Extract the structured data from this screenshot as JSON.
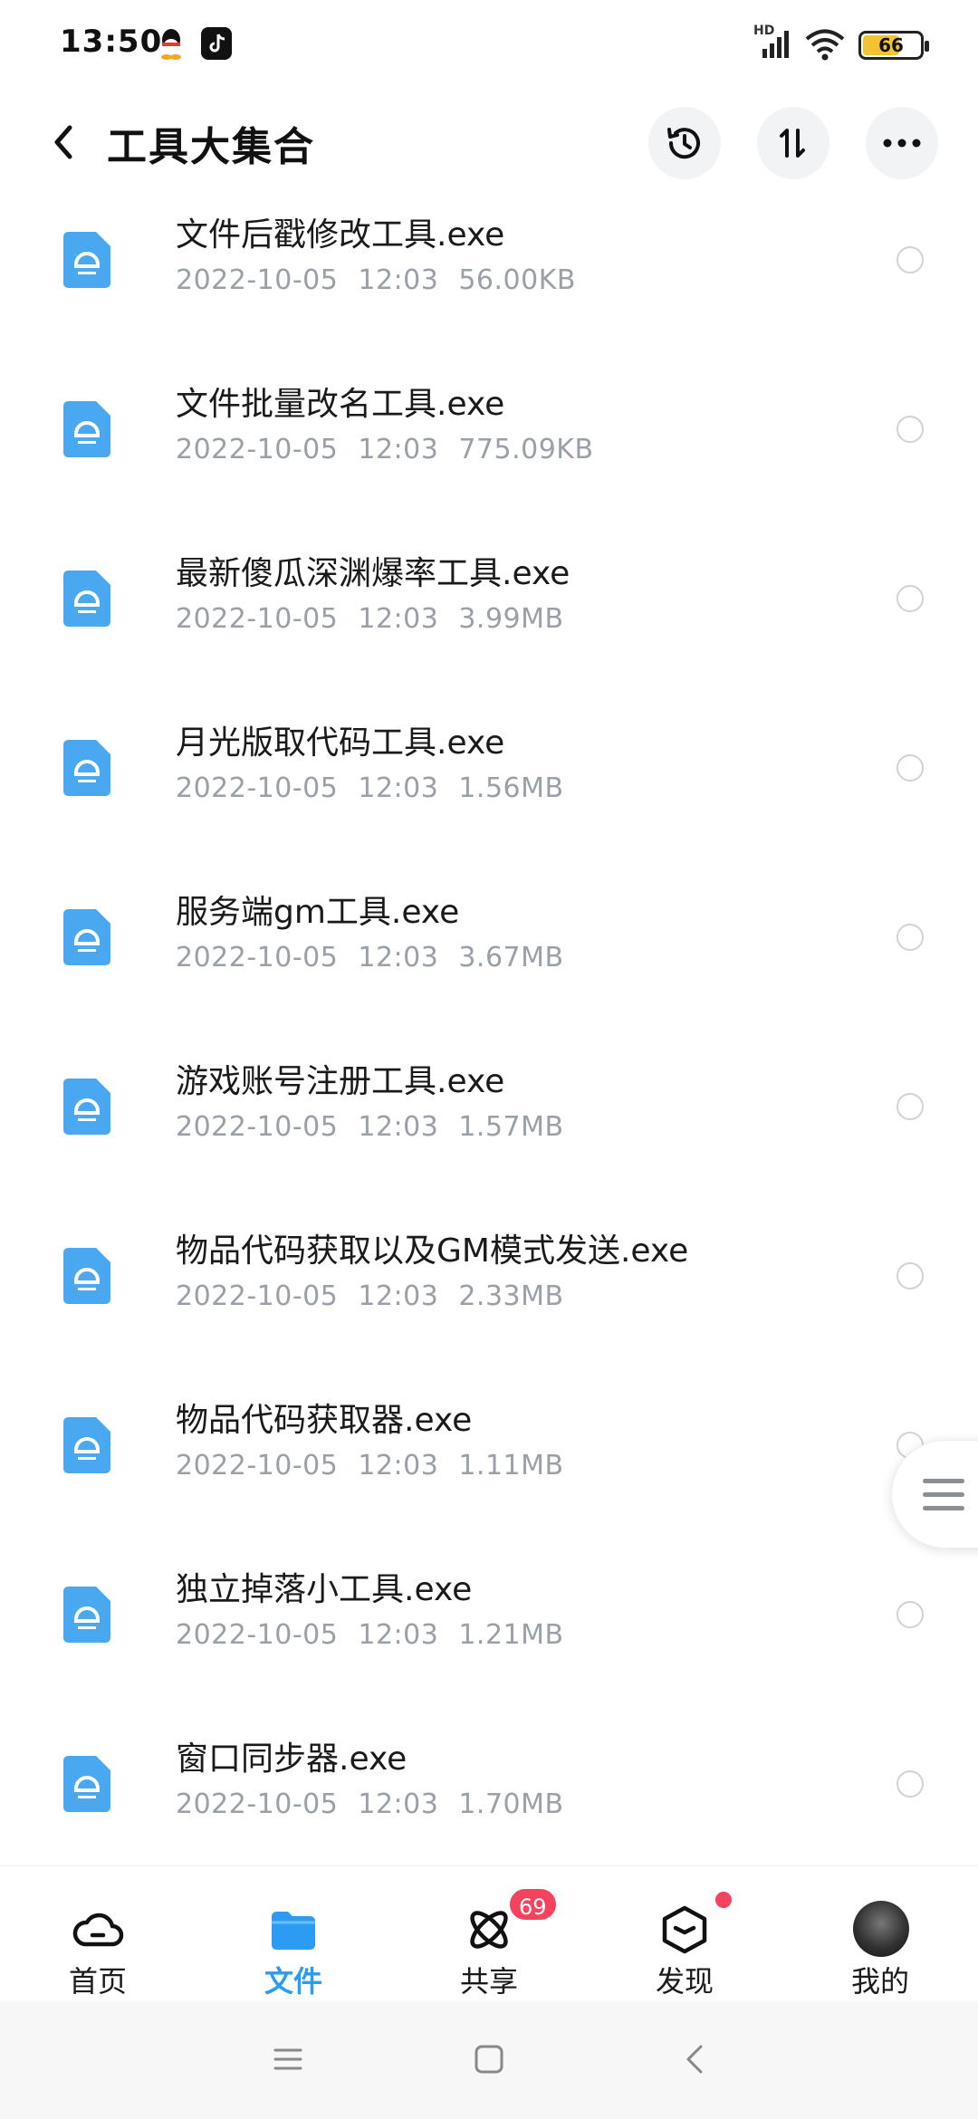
{
  "status_bar": {
    "time": "13:50",
    "network_label": "HD",
    "battery_level": 66,
    "battery_text": "66",
    "icons": [
      "qq-icon",
      "tiktok-icon",
      "signal-icon",
      "wifi-icon",
      "battery-icon"
    ]
  },
  "header": {
    "title": "工具大集合",
    "actions": [
      "back-arrow-icon",
      "history-icon",
      "sort-icon",
      "more-icon"
    ]
  },
  "files": [
    {
      "name": "文件后戳修改工具.exe",
      "date": "2022-10-05",
      "time": "12:03",
      "size": "56.00KB"
    },
    {
      "name": "文件批量改名工具.exe",
      "date": "2022-10-05",
      "time": "12:03",
      "size": "775.09KB"
    },
    {
      "name": "最新傻瓜深渊爆率工具.exe",
      "date": "2022-10-05",
      "time": "12:03",
      "size": "3.99MB"
    },
    {
      "name": "月光版取代码工具.exe",
      "date": "2022-10-05",
      "time": "12:03",
      "size": "1.56MB"
    },
    {
      "name": "服务端gm工具.exe",
      "date": "2022-10-05",
      "time": "12:03",
      "size": "3.67MB"
    },
    {
      "name": "游戏账号注册工具.exe",
      "date": "2022-10-05",
      "time": "12:03",
      "size": "1.57MB"
    },
    {
      "name": "物品代码获取以及GM模式发送.exe",
      "date": "2022-10-05",
      "time": "12:03",
      "size": "2.33MB"
    },
    {
      "name": "物品代码获取器.exe",
      "date": "2022-10-05",
      "time": "12:03",
      "size": "1.11MB"
    },
    {
      "name": "独立掉落小工具.exe",
      "date": "2022-10-05",
      "time": "12:03",
      "size": "1.21MB"
    },
    {
      "name": "窗口同步器.exe",
      "date": "2022-10-05",
      "time": "12:03",
      "size": "1.70MB"
    }
  ],
  "bottom_nav": {
    "items": [
      {
        "label": "首页",
        "icon": "cloud-icon"
      },
      {
        "label": "文件",
        "icon": "folder-icon",
        "active": true
      },
      {
        "label": "共享",
        "icon": "share-atom-icon"
      },
      {
        "label": "发现",
        "icon": "discover-cube-icon"
      },
      {
        "label": "我的",
        "icon": "avatar"
      }
    ],
    "share_badge": "69"
  },
  "colors": {
    "accent": "#2b9bf4",
    "file_icon": "#4aa8f0",
    "badge": "#f5425e",
    "meta_text": "#9aa0a8"
  }
}
